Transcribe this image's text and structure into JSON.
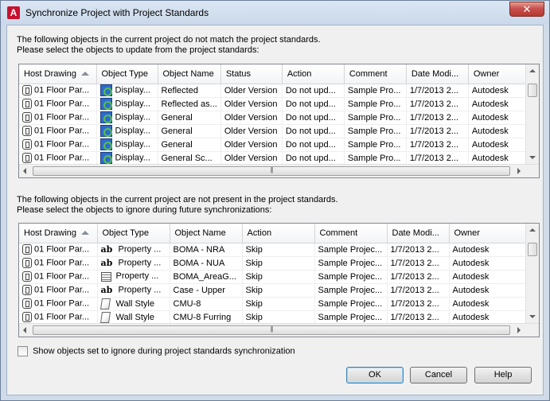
{
  "window": {
    "title": "Synchronize Project with Project Standards",
    "app_icon_letter": "A",
    "close_glyph": "✕"
  },
  "section1": {
    "intro_line1": "The following objects in the current project do not match the project standards.",
    "intro_line2": "Please select the objects to update from the project standards:",
    "columns": [
      "Host Drawing",
      "Object Type",
      "Object Name",
      "Status",
      "Action",
      "Comment",
      "Date Modi...",
      "Owner"
    ],
    "rows": [
      {
        "host": "01 Floor Par...",
        "type": "Display...",
        "name": "Reflected",
        "status": "Older Version",
        "action": "Do not upd...",
        "comment": "Sample Pro...",
        "date": "1/7/2013 2...",
        "owner": "Autodesk"
      },
      {
        "host": "01 Floor Par...",
        "type": "Display...",
        "name": "Reflected as...",
        "status": "Older Version",
        "action": "Do not upd...",
        "comment": "Sample Pro...",
        "date": "1/7/2013 2...",
        "owner": "Autodesk"
      },
      {
        "host": "01 Floor Par...",
        "type": "Display...",
        "name": "General",
        "status": "Older Version",
        "action": "Do not upd...",
        "comment": "Sample Pro...",
        "date": "1/7/2013 2...",
        "owner": "Autodesk"
      },
      {
        "host": "01 Floor Par...",
        "type": "Display...",
        "name": "General",
        "status": "Older Version",
        "action": "Do not upd...",
        "comment": "Sample Pro...",
        "date": "1/7/2013 2...",
        "owner": "Autodesk"
      },
      {
        "host": "01 Floor Par...",
        "type": "Display...",
        "name": "General",
        "status": "Older Version",
        "action": "Do not upd...",
        "comment": "Sample Pro...",
        "date": "1/7/2013 2...",
        "owner": "Autodesk"
      },
      {
        "host": "01 Floor Par...",
        "type": "Display...",
        "name": "General Sc...",
        "status": "Older Version",
        "action": "Do not upd...",
        "comment": "Sample Pro...",
        "date": "1/7/2013 2...",
        "owner": "Autodesk"
      }
    ]
  },
  "section2": {
    "intro_line1": "The following objects in the current project are not present in the project standards.",
    "intro_line2": "Please select the objects to ignore during future synchronizations:",
    "columns": [
      "Host Drawing",
      "Object Type",
      "Object Name",
      "Action",
      "Comment",
      "Date Modi...",
      "Owner"
    ],
    "rows": [
      {
        "host": "01 Floor Par...",
        "icon": "ab-icon",
        "type": "Property ...",
        "name": "BOMA - NRA",
        "action": "Skip",
        "comment": "Sample Projec...",
        "date": "1/7/2013 2...",
        "owner": "Autodesk"
      },
      {
        "host": "01 Floor Par...",
        "icon": "ab-icon",
        "type": "Property ...",
        "name": "BOMA - NUA",
        "action": "Skip",
        "comment": "Sample Projec...",
        "date": "1/7/2013 2...",
        "owner": "Autodesk"
      },
      {
        "host": "01 Floor Par...",
        "icon": "table-icon",
        "type": "Property ...",
        "name": "BOMA_AreaG...",
        "action": "Skip",
        "comment": "Sample Projec...",
        "date": "1/7/2013 2...",
        "owner": "Autodesk"
      },
      {
        "host": "01 Floor Par...",
        "icon": "ab-icon",
        "type": "Property ...",
        "name": "Case - Upper",
        "action": "Skip",
        "comment": "Sample Projec...",
        "date": "1/7/2013 2...",
        "owner": "Autodesk"
      },
      {
        "host": "01 Floor Par...",
        "icon": "wall-style-icon",
        "type": "Wall Style",
        "name": "CMU-8",
        "action": "Skip",
        "comment": "Sample Projec...",
        "date": "1/7/2013 2...",
        "owner": "Autodesk"
      },
      {
        "host": "01 Floor Par...",
        "icon": "wall-style-icon",
        "type": "Wall Style",
        "name": "CMU-8 Furring",
        "action": "Skip",
        "comment": "Sample Projec...",
        "date": "1/7/2013 2...",
        "owner": "Autodesk"
      }
    ]
  },
  "checkbox_label": "Show objects set to ignore during project standards synchronization",
  "buttons": {
    "ok": "OK",
    "cancel": "Cancel",
    "help": "Help"
  }
}
